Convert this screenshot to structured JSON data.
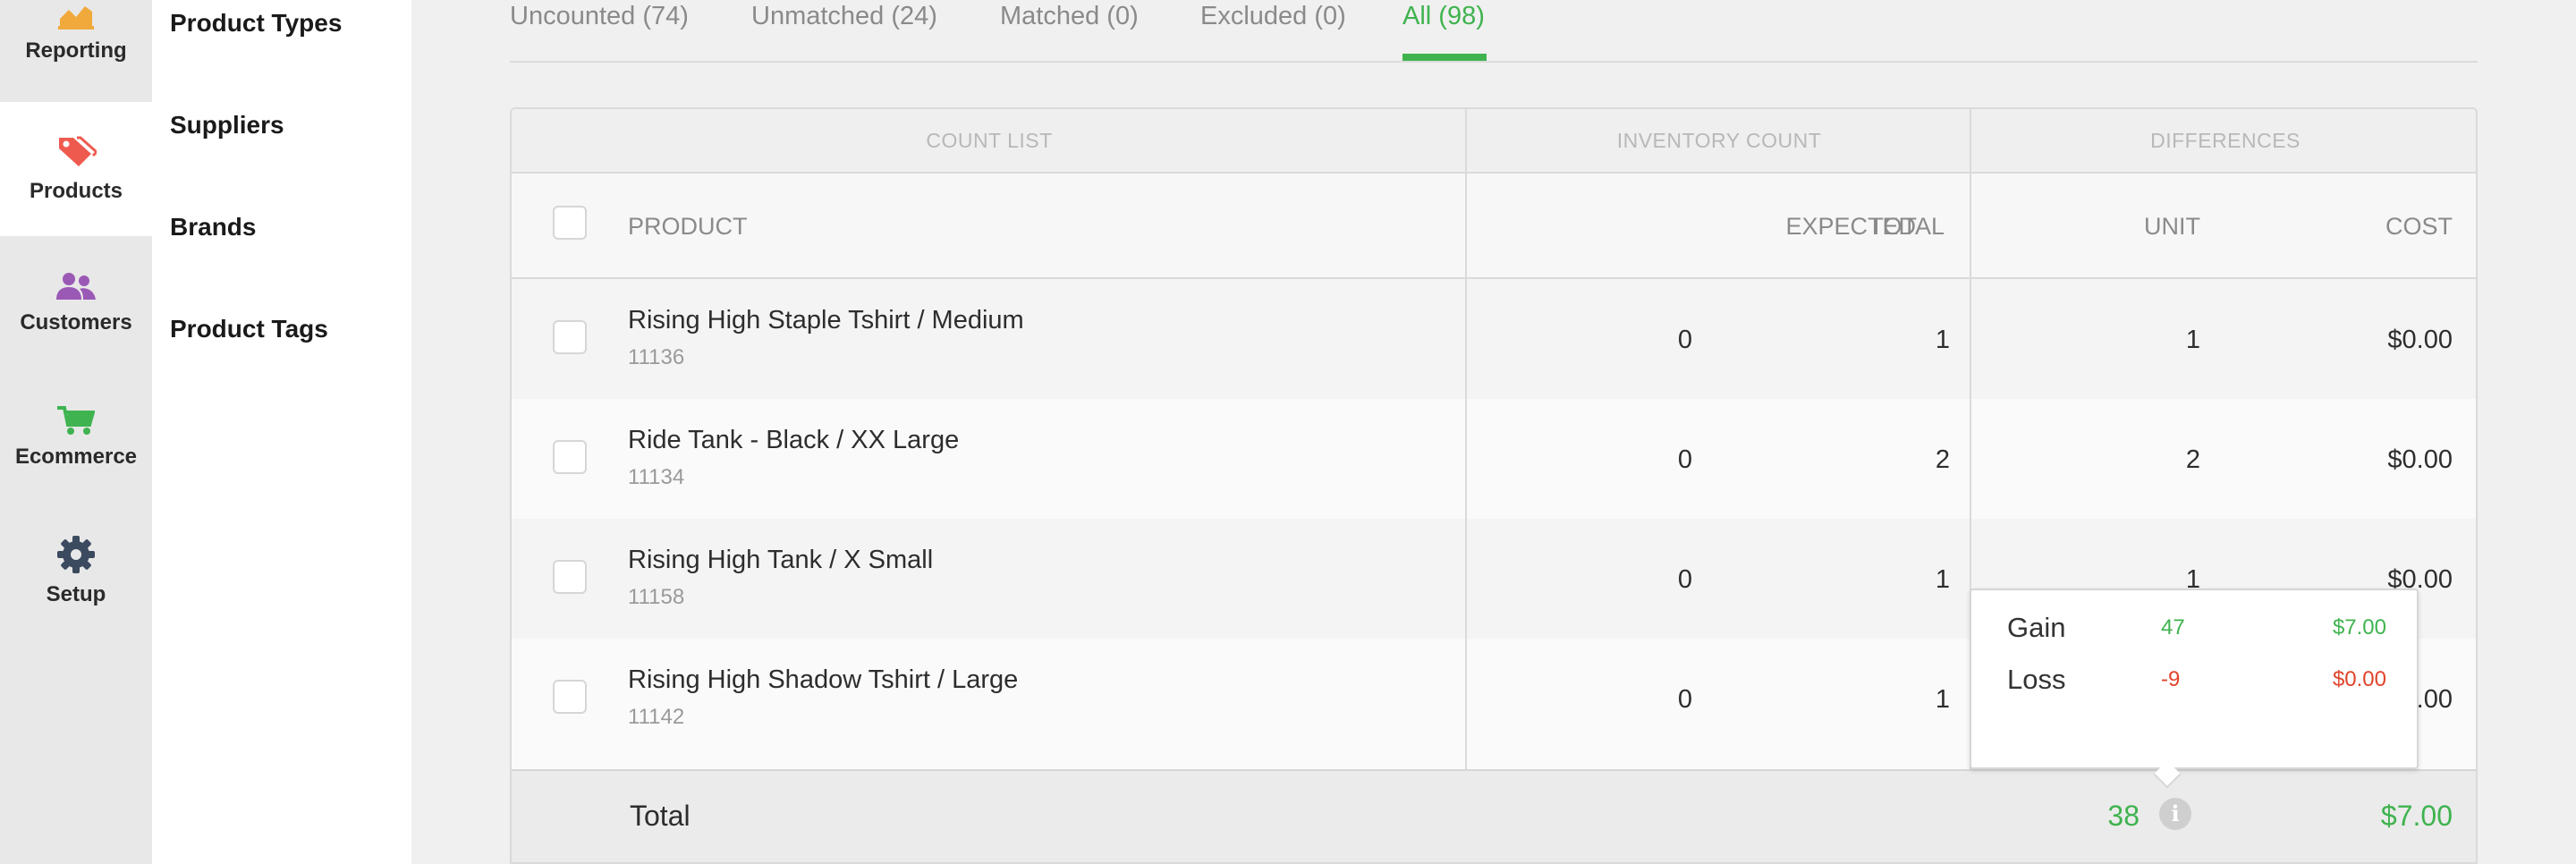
{
  "nav": {
    "items": [
      {
        "label": "Reporting",
        "icon": "chart-icon",
        "color": "#f0a93a",
        "active": false
      },
      {
        "label": "Products",
        "icon": "tag-icon",
        "color": "#ef5a4f",
        "active": true
      },
      {
        "label": "Customers",
        "icon": "people-icon",
        "color": "#9b59b6",
        "active": false
      },
      {
        "label": "Ecommerce",
        "icon": "cart-icon",
        "color": "#3fb34f",
        "active": false
      },
      {
        "label": "Setup",
        "icon": "gear-icon",
        "color": "#3b4a5e",
        "active": false
      }
    ]
  },
  "submenu": {
    "items": [
      "Product Types",
      "Suppliers",
      "Brands",
      "Product Tags"
    ]
  },
  "tabs": [
    {
      "label": "Uncounted (74)",
      "active": false
    },
    {
      "label": "Unmatched (24)",
      "active": false
    },
    {
      "label": "Matched (0)",
      "active": false
    },
    {
      "label": "Excluded (0)",
      "active": false
    },
    {
      "label": "All (98)",
      "active": true
    }
  ],
  "table": {
    "groups": [
      "COUNT LIST",
      "INVENTORY COUNT",
      "DIFFERENCES"
    ],
    "columns": {
      "product": "PRODUCT",
      "expected": "EXPECTED",
      "total": "TOTAL",
      "unit": "UNIT",
      "cost": "COST"
    },
    "rows": [
      {
        "name": "Rising High Staple Tshirt / Medium",
        "sku": "11136",
        "expected": "0",
        "total": "1",
        "unit": "1",
        "cost": "$0.00"
      },
      {
        "name": "Ride Tank - Black / XX Large",
        "sku": "11134",
        "expected": "0",
        "total": "2",
        "unit": "2",
        "cost": "$0.00"
      },
      {
        "name": "Rising High Tank / X Small",
        "sku": "11158",
        "expected": "0",
        "total": "1",
        "unit": "1",
        "cost": "$0.00"
      },
      {
        "name": "Rising High Shadow Tshirt / Large",
        "sku": "11142",
        "expected": "0",
        "total": "1",
        "unit": "",
        "cost": ".00"
      }
    ],
    "total": {
      "label": "Total",
      "unit": "38",
      "cost": "$7.00"
    }
  },
  "popover": {
    "gain": {
      "label": "Gain",
      "units": "47",
      "cost": "$7.00"
    },
    "loss": {
      "label": "Loss",
      "units": "-9",
      "cost": "$0.00"
    }
  },
  "info_icon": "info-icon",
  "colors": {
    "accent": "#3fb34f",
    "negative": "#e0442b"
  }
}
